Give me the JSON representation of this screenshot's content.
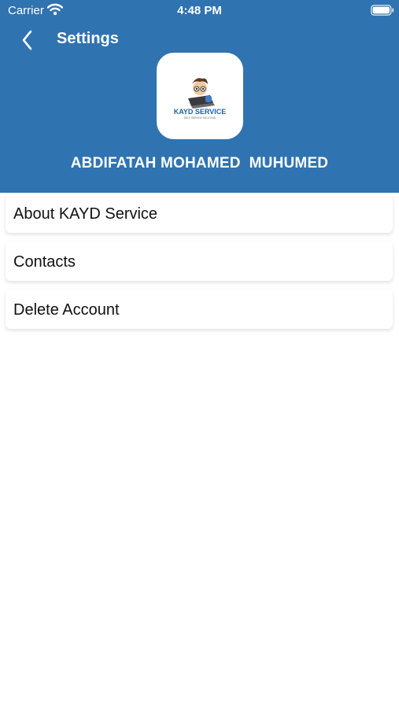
{
  "status_bar": {
    "carrier": "Carrier",
    "time": "4:48 PM",
    "icons": [
      "wifi-icon",
      "battery-icon"
    ]
  },
  "nav": {
    "title": "Settings",
    "back_icon": "chevron-left-icon"
  },
  "profile": {
    "logo_text": "KAYD SERVICE",
    "logo_subtext": "SELF SERVICE SOLUTION",
    "name": "ABDIFATAH MOHAMED  MUHUMED"
  },
  "menu": {
    "items": [
      {
        "label": "About KAYD Service"
      },
      {
        "label": "Contacts"
      },
      {
        "label": "Delete Account"
      }
    ]
  },
  "colors": {
    "header_bg": "#2f73b1",
    "page_bg": "#ffffff",
    "text_primary": "#111111",
    "header_text": "#ffffff"
  }
}
